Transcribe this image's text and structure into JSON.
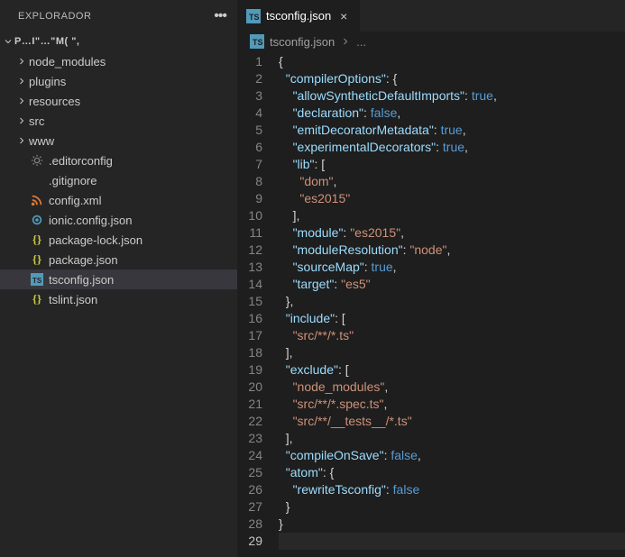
{
  "sidebar": {
    "title": "EXPLORADOR",
    "project": "P…I\"…\"M(  \",",
    "folders": [
      {
        "label": "node_modules"
      },
      {
        "label": "plugins"
      },
      {
        "label": "resources"
      },
      {
        "label": "src"
      },
      {
        "label": "www"
      }
    ],
    "files": [
      {
        "label": ".editorconfig",
        "icon": "gear",
        "color": "#818181"
      },
      {
        "label": ".gitignore",
        "icon": "blank",
        "color": "#818181"
      },
      {
        "label": "config.xml",
        "icon": "rss",
        "color": "#e37933"
      },
      {
        "label": "ionic.config.json",
        "icon": "circle",
        "color": "#519aba"
      },
      {
        "label": "package-lock.json",
        "icon": "braces",
        "color": "#cbcb41"
      },
      {
        "label": "package.json",
        "icon": "braces",
        "color": "#cbcb41"
      },
      {
        "label": "tsconfig.json",
        "icon": "ts",
        "color": "#519aba",
        "selected": true
      },
      {
        "label": "tslint.json",
        "icon": "braces",
        "color": "#cbcb41"
      }
    ]
  },
  "tab": {
    "label": "tsconfig.json",
    "icon_color": "#519aba"
  },
  "breadcrumb": {
    "file": "tsconfig.json",
    "rest": "..."
  },
  "chart_data": {
    "type": "table",
    "description": "Contents of tsconfig.json shown in editor",
    "file": "tsconfig.json",
    "json": {
      "compilerOptions": {
        "allowSyntheticDefaultImports": true,
        "declaration": false,
        "emitDecoratorMetadata": true,
        "experimentalDecorators": true,
        "lib": [
          "dom",
          "es2015"
        ],
        "module": "es2015",
        "moduleResolution": "node",
        "sourceMap": true,
        "target": "es5"
      },
      "include": [
        "src/**/*.ts"
      ],
      "exclude": [
        "node_modules",
        "src/**/*.spec.ts",
        "src/**/__tests__/*.ts"
      ],
      "compileOnSave": false,
      "atom": {
        "rewriteTsconfig": false
      }
    }
  },
  "code_lines": [
    [
      [
        "br",
        "{"
      ]
    ],
    [
      [
        "pn",
        "  "
      ],
      [
        "key",
        "\"compilerOptions\""
      ],
      [
        "pn",
        ": "
      ],
      [
        "br",
        "{"
      ]
    ],
    [
      [
        "pn",
        "    "
      ],
      [
        "key",
        "\"allowSyntheticDefaultImports\""
      ],
      [
        "pn",
        ": "
      ],
      [
        "kw",
        "true"
      ],
      [
        "pn",
        ","
      ]
    ],
    [
      [
        "pn",
        "    "
      ],
      [
        "key",
        "\"declaration\""
      ],
      [
        "pn",
        ": "
      ],
      [
        "kw",
        "false"
      ],
      [
        "pn",
        ","
      ]
    ],
    [
      [
        "pn",
        "    "
      ],
      [
        "key",
        "\"emitDecoratorMetadata\""
      ],
      [
        "pn",
        ": "
      ],
      [
        "kw",
        "true"
      ],
      [
        "pn",
        ","
      ]
    ],
    [
      [
        "pn",
        "    "
      ],
      [
        "key",
        "\"experimentalDecorators\""
      ],
      [
        "pn",
        ": "
      ],
      [
        "kw",
        "true"
      ],
      [
        "pn",
        ","
      ]
    ],
    [
      [
        "pn",
        "    "
      ],
      [
        "key",
        "\"lib\""
      ],
      [
        "pn",
        ": "
      ],
      [
        "br",
        "["
      ]
    ],
    [
      [
        "pn",
        "      "
      ],
      [
        "str",
        "\"dom\""
      ],
      [
        "pn",
        ","
      ]
    ],
    [
      [
        "pn",
        "      "
      ],
      [
        "str",
        "\"es2015\""
      ]
    ],
    [
      [
        "pn",
        "    "
      ],
      [
        "br",
        "]"
      ],
      [
        "pn",
        ","
      ]
    ],
    [
      [
        "pn",
        "    "
      ],
      [
        "key",
        "\"module\""
      ],
      [
        "pn",
        ": "
      ],
      [
        "str",
        "\"es2015\""
      ],
      [
        "pn",
        ","
      ]
    ],
    [
      [
        "pn",
        "    "
      ],
      [
        "key",
        "\"moduleResolution\""
      ],
      [
        "pn",
        ": "
      ],
      [
        "str",
        "\"node\""
      ],
      [
        "pn",
        ","
      ]
    ],
    [
      [
        "pn",
        "    "
      ],
      [
        "key",
        "\"sourceMap\""
      ],
      [
        "pn",
        ": "
      ],
      [
        "kw",
        "true"
      ],
      [
        "pn",
        ","
      ]
    ],
    [
      [
        "pn",
        "    "
      ],
      [
        "key",
        "\"target\""
      ],
      [
        "pn",
        ": "
      ],
      [
        "str",
        "\"es5\""
      ]
    ],
    [
      [
        "pn",
        "  "
      ],
      [
        "br",
        "}"
      ],
      [
        "pn",
        ","
      ]
    ],
    [
      [
        "pn",
        "  "
      ],
      [
        "key",
        "\"include\""
      ],
      [
        "pn",
        ": "
      ],
      [
        "br",
        "["
      ]
    ],
    [
      [
        "pn",
        "    "
      ],
      [
        "str",
        "\"src/**/*.ts\""
      ]
    ],
    [
      [
        "pn",
        "  "
      ],
      [
        "br",
        "]"
      ],
      [
        "pn",
        ","
      ]
    ],
    [
      [
        "pn",
        "  "
      ],
      [
        "key",
        "\"exclude\""
      ],
      [
        "pn",
        ": "
      ],
      [
        "br",
        "["
      ]
    ],
    [
      [
        "pn",
        "    "
      ],
      [
        "str",
        "\"node_modules\""
      ],
      [
        "pn",
        ","
      ]
    ],
    [
      [
        "pn",
        "    "
      ],
      [
        "str",
        "\"src/**/*.spec.ts\""
      ],
      [
        "pn",
        ","
      ]
    ],
    [
      [
        "pn",
        "    "
      ],
      [
        "str",
        "\"src/**/__tests__/*.ts\""
      ]
    ],
    [
      [
        "pn",
        "  "
      ],
      [
        "br",
        "]"
      ],
      [
        "pn",
        ","
      ]
    ],
    [
      [
        "pn",
        "  "
      ],
      [
        "key",
        "\"compileOnSave\""
      ],
      [
        "pn",
        ": "
      ],
      [
        "kw",
        "false"
      ],
      [
        "pn",
        ","
      ]
    ],
    [
      [
        "pn",
        "  "
      ],
      [
        "key",
        "\"atom\""
      ],
      [
        "pn",
        ": "
      ],
      [
        "br",
        "{"
      ]
    ],
    [
      [
        "pn",
        "    "
      ],
      [
        "key",
        "\"rewriteTsconfig\""
      ],
      [
        "pn",
        ": "
      ],
      [
        "kw",
        "false"
      ]
    ],
    [
      [
        "pn",
        "  "
      ],
      [
        "br",
        "}"
      ]
    ],
    [
      [
        "br",
        "}"
      ]
    ],
    []
  ],
  "current_line": 29
}
